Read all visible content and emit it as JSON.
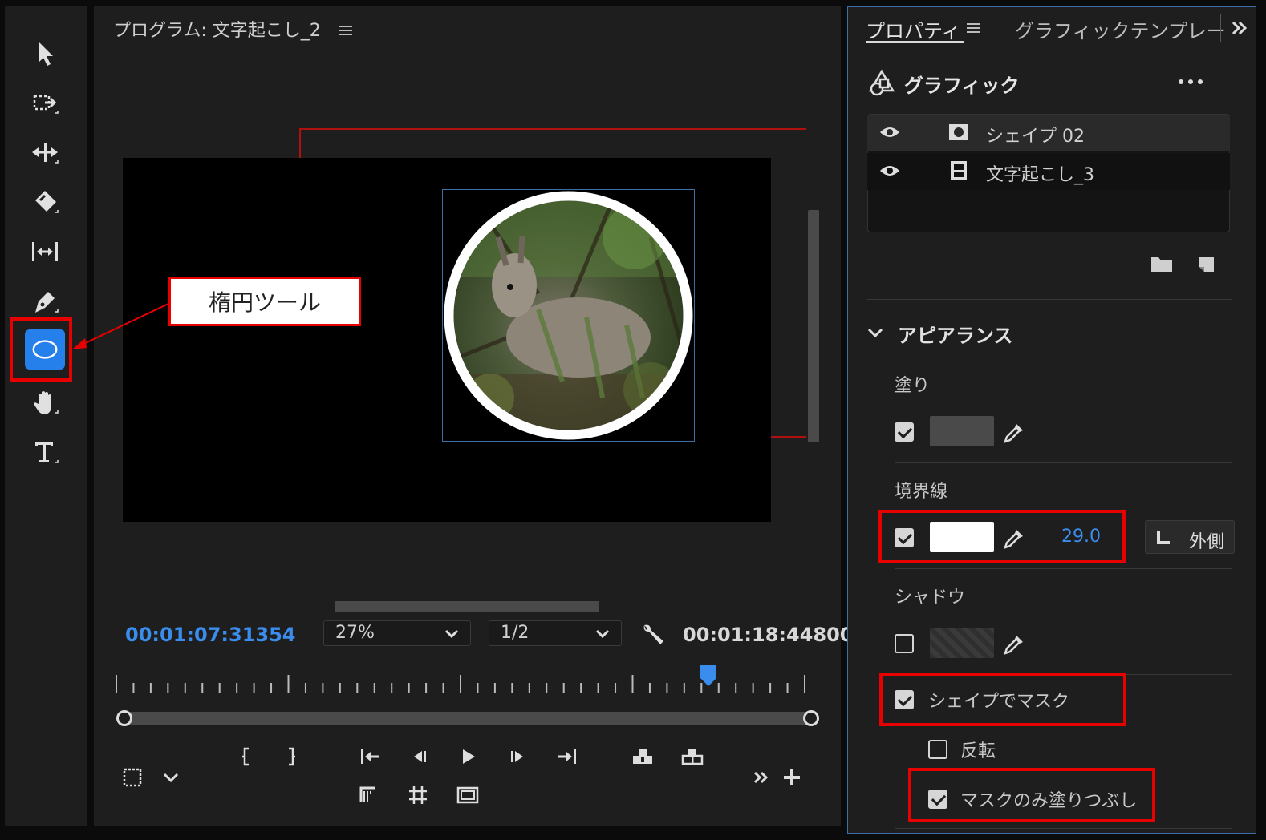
{
  "tools": {
    "items": [
      "selection",
      "track-select",
      "ripple-edit",
      "razor",
      "slip",
      "pen",
      "ellipse",
      "hand",
      "type"
    ],
    "active": "ellipse"
  },
  "callout": {
    "text": "楕円ツール"
  },
  "program": {
    "title": "プログラム: 文字起こし_2",
    "current_time": "00:01:07:31354",
    "zoom": "27%",
    "resolution": "1/2",
    "duration": "00:01:18:44800",
    "playhead_fraction": 0.86
  },
  "properties": {
    "tab_active": "プロパティ",
    "tab_inactive": "グラフィックテンプレー",
    "section_title": "グラフィック",
    "layers": [
      {
        "name": "シェイプ 02",
        "type": "shape"
      },
      {
        "name": "文字起こし_3",
        "type": "clip"
      }
    ],
    "appearance_title": "アピアランス",
    "fill": {
      "label": "塗り",
      "checked": true,
      "color": "#4a4a4a"
    },
    "stroke": {
      "label": "境界線",
      "checked": true,
      "color": "#ffffff",
      "width": "29.0",
      "position": "外側"
    },
    "shadow": {
      "label": "シャドウ",
      "checked": false
    },
    "mask": {
      "label": "シェイプでマスク",
      "checked": true
    },
    "invert": {
      "label": "反転",
      "checked": false
    },
    "fill_mask_only": {
      "label": "マスクのみ塗りつぶし",
      "checked": true
    }
  },
  "colors": {
    "accent_blue": "#2680eb",
    "timecode_blue": "#3b8ded",
    "highlight_red": "#e60000",
    "panel_bg": "#1e1e1e"
  }
}
